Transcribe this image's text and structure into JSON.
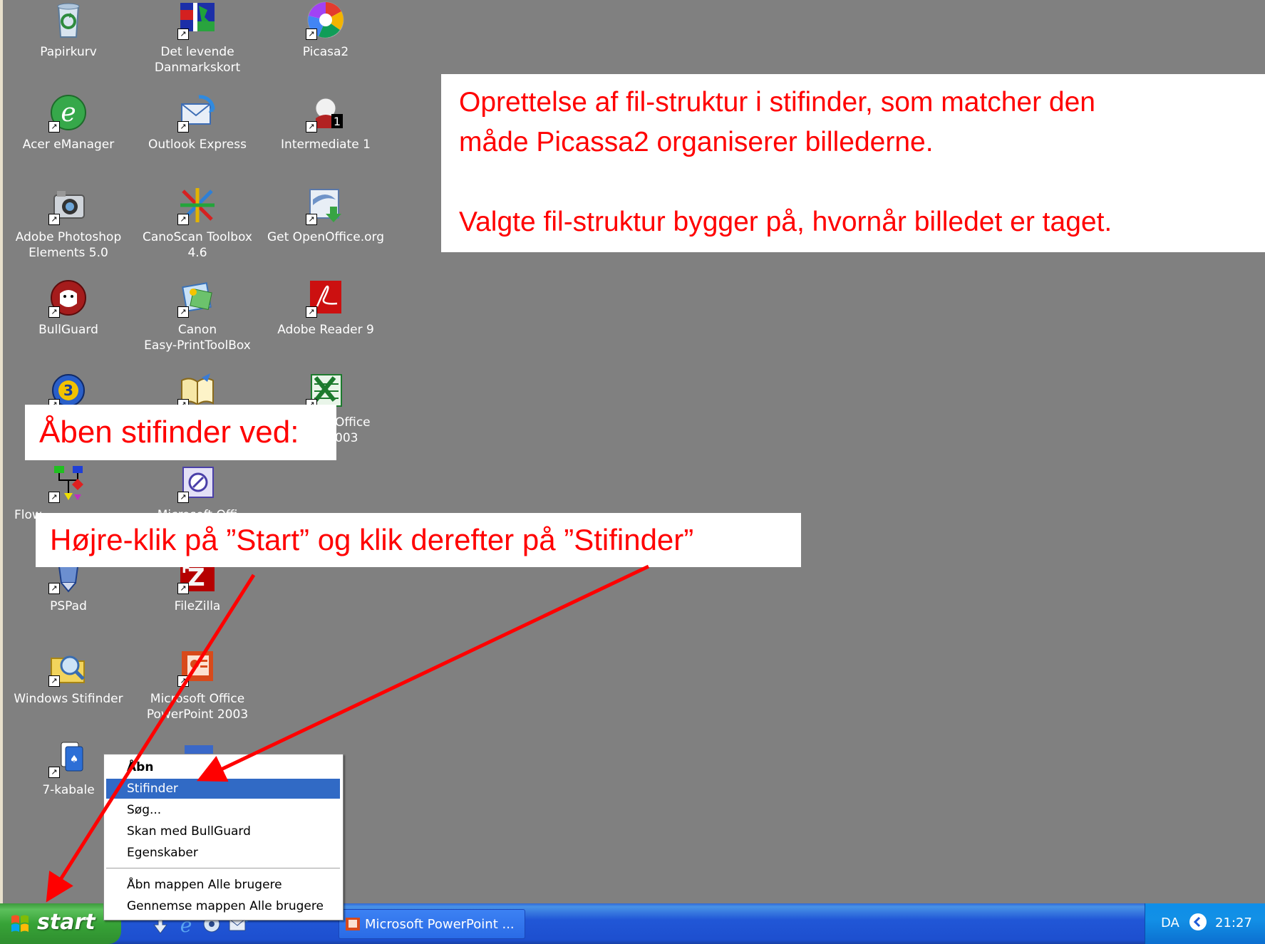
{
  "desktop_icons": [
    {
      "label": "Papirkurv",
      "icon": "recycle-bin-icon"
    },
    {
      "label": "Det levende\nDanmarkskort",
      "icon": "denmark-map-icon"
    },
    {
      "label": "Picasa2",
      "icon": "picasa-icon"
    },
    {
      "label": "Acer eManager",
      "icon": "acer-emanager-icon"
    },
    {
      "label": "Outlook Express",
      "icon": "outlook-express-icon"
    },
    {
      "label": "Intermediate 1",
      "icon": "intermediate-icon"
    },
    {
      "label": "Adobe Photoshop\nElements 5.0",
      "icon": "photoshop-elements-icon"
    },
    {
      "label": "CanoScan Toolbox\n4.6",
      "icon": "canoscan-toolbox-icon"
    },
    {
      "label": "Get OpenOffice.org",
      "icon": "openoffice-icon"
    },
    {
      "label": "BullGuard",
      "icon": "bullguard-icon"
    },
    {
      "label": "Canon\nEasy-PrintToolBox",
      "icon": "canon-easyprint-icon"
    },
    {
      "label": "Adobe Reader 9",
      "icon": "adobe-reader-icon"
    },
    {
      "label": "Office\n003",
      "icon": "excel-icon"
    },
    {
      "label": "PSPad",
      "icon": "pspad-icon"
    },
    {
      "label": "FileZilla",
      "icon": "filezilla-icon"
    },
    {
      "label": "Windows Stifinder",
      "icon": "windows-explorer-icon"
    },
    {
      "label": "Microsoft Office\nPowerPoint 2003",
      "icon": "powerpoint-icon"
    },
    {
      "label": "7-kabale",
      "icon": "solitaire-icon"
    }
  ],
  "partial_labels": {
    "flowchart": "Flow",
    "msoffice": "Microsoft Offi"
  },
  "callouts": {
    "top_line1": "Oprettelse af fil-struktur i stifinder, som matcher den",
    "top_line2": "måde Picassa2 organiserer billederne.",
    "top_line3": "Valgte fil-struktur bygger på, hvornår billedet er taget.",
    "open_explorer": "Åben stifinder ved:",
    "instruction": "Højre-klik på ”Start” og klik derefter på ”Stifinder”"
  },
  "context_menu": {
    "items": [
      {
        "label": "Åbn",
        "bold": true
      },
      {
        "label": "Stifinder",
        "selected": true
      },
      {
        "label": "Søg..."
      },
      {
        "label": "Skan med BullGuard"
      },
      {
        "label": "Egenskaber"
      },
      {
        "label": "Åbn mappen Alle brugere"
      },
      {
        "label": "Gennemse mappen Alle brugere"
      }
    ]
  },
  "taskbar": {
    "start_label": "start",
    "window_button": "Microsoft PowerPoint ...",
    "language": "DA",
    "clock": "21:27"
  },
  "colors": {
    "desktop": "#808080",
    "callout_text": "#ff0000",
    "menu_highlight": "#316ac5",
    "taskbar": "#245edb",
    "start_button": "#3c9a3c",
    "arrow": "#ff0000"
  }
}
